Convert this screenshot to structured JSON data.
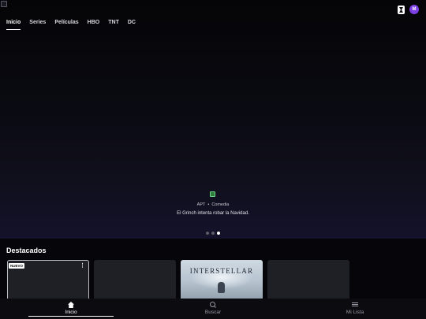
{
  "nav": {
    "tabs": [
      "Inicio",
      "Series",
      "Películas",
      "HBO",
      "TNT",
      "DC"
    ]
  },
  "header": {
    "avatar_initial": "M",
    "cast_icon": "chromecast-icon"
  },
  "hero": {
    "genre_tag": "APT",
    "genre": "Comedia",
    "separator": "•",
    "synopsis": "El Grinch intenta robar la Navidad.",
    "carousel": {
      "count": 3,
      "active": 3
    }
  },
  "featured": {
    "title": "Destacados",
    "badge": "NUEVO",
    "poster_title": "INTERSTELLAR"
  },
  "tabbar": {
    "home": "Inicio",
    "search": "Buscar",
    "list": "Mi Lista"
  },
  "colors": {
    "accent": "#7b3fe4",
    "background": "#06060a"
  }
}
